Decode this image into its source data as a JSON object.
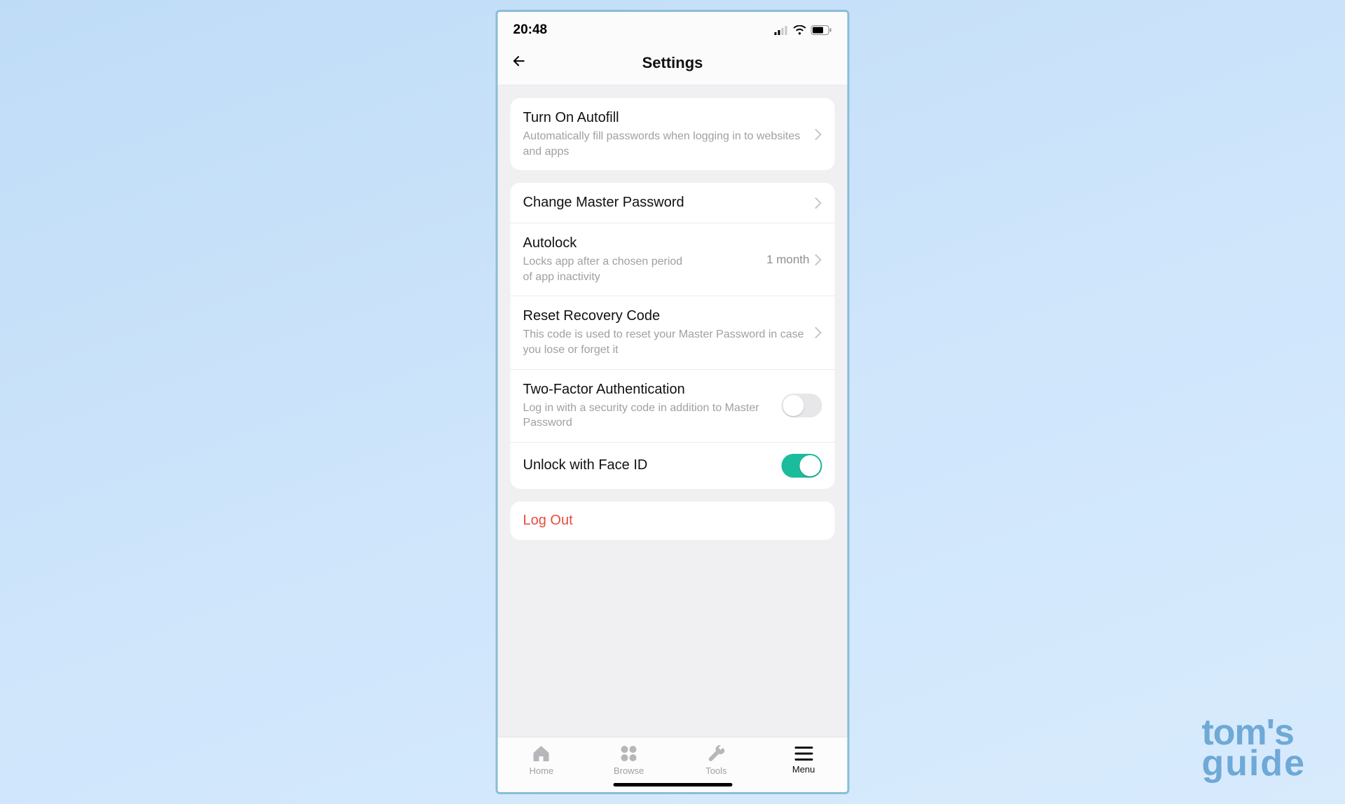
{
  "status": {
    "time": "20:48"
  },
  "header": {
    "title": "Settings"
  },
  "section1": {
    "autofill": {
      "title": "Turn On Autofill",
      "sub": "Automatically fill passwords when logging in to websites and apps"
    }
  },
  "section2": {
    "changePassword": {
      "title": "Change Master Password"
    },
    "autolock": {
      "title": "Autolock",
      "sub": "Locks app after a chosen period of app inactivity",
      "value": "1 month"
    },
    "recovery": {
      "title": "Reset Recovery Code",
      "sub": "This code is used to reset your Master Password in case you lose or forget it"
    },
    "twofa": {
      "title": "Two-Factor Authentication",
      "sub": "Log in with a security code in addition to Master Password",
      "enabled": false
    },
    "faceid": {
      "title": "Unlock with Face ID",
      "enabled": true
    }
  },
  "section3": {
    "logout": "Log Out"
  },
  "tabs": {
    "home": "Home",
    "browse": "Browse",
    "tools": "Tools",
    "menu": "Menu"
  },
  "watermark": {
    "l1": "tom's",
    "l2": "guide"
  },
  "colors": {
    "toggle_on": "#1abc9c",
    "logout": "#e74c3c",
    "background_start": "#bfdcf7",
    "frame_border": "#88bdd8"
  }
}
